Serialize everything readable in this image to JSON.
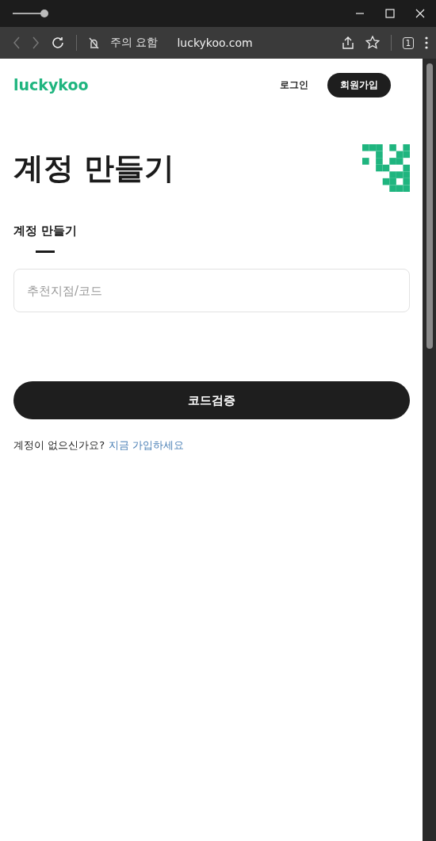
{
  "browser": {
    "security_label": "주의 요함",
    "url": "luckykoo.com",
    "tab_count": "1"
  },
  "header": {
    "logo": "luckykoo",
    "login": "로그인",
    "signup": "회원가입"
  },
  "title": "계정 만들기",
  "tabs": [
    {
      "label": "계정 만들기",
      "selected": true
    }
  ],
  "code_field": {
    "placeholder": "추천지점/코드"
  },
  "submit_button": "코드검증",
  "footer": {
    "question": "계정이 없으신가요?",
    "link": "지금 가입하세요"
  }
}
